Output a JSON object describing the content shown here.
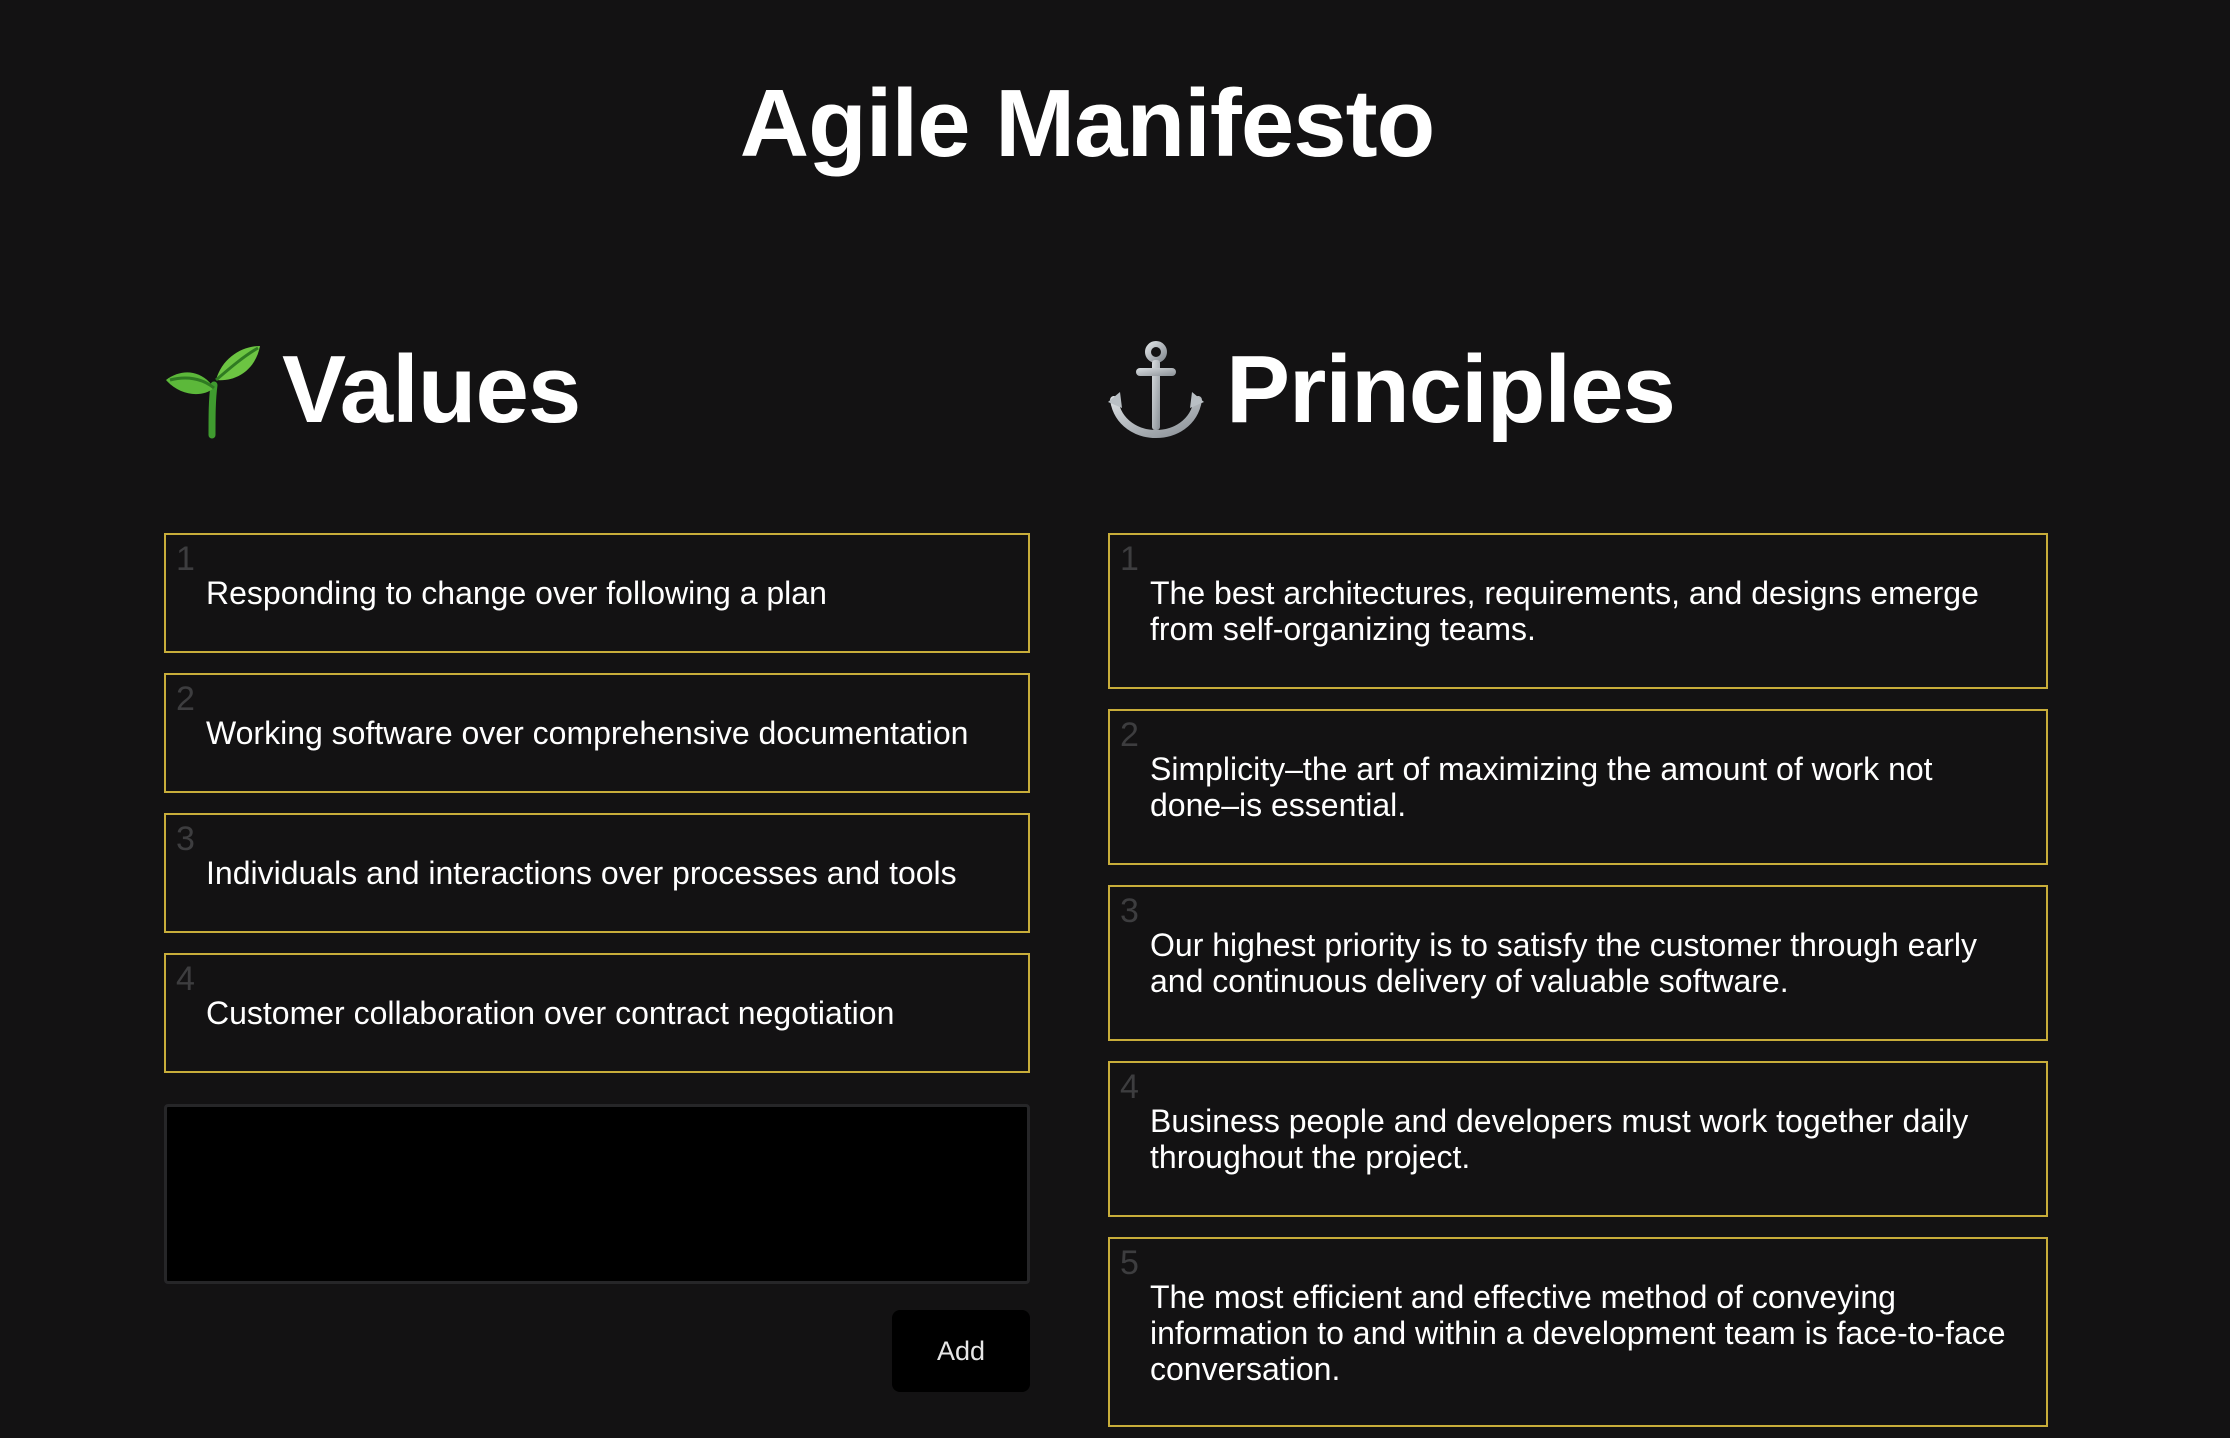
{
  "page": {
    "title": "Agile Manifesto"
  },
  "values": {
    "heading": "Values",
    "icon": "seedling-icon",
    "items": [
      {
        "index": "1",
        "text": "Responding to change over following a plan"
      },
      {
        "index": "2",
        "text": "Working software over comprehensive documentation"
      },
      {
        "index": "3",
        "text": "Individuals and interactions over processes and tools"
      },
      {
        "index": "4",
        "text": "Customer collaboration over contract negotiation"
      }
    ],
    "input_value": "",
    "add_label": "Add"
  },
  "principles": {
    "heading": "Principles",
    "icon": "anchor-icon",
    "items": [
      {
        "index": "1",
        "text": "The best architectures, requirements, and designs emerge from self-organizing teams."
      },
      {
        "index": "2",
        "text": "Simplicity–the art of maximizing the amount of work not done–is essential."
      },
      {
        "index": "3",
        "text": "Our highest priority is to satisfy the customer through early and continuous delivery of valuable software."
      },
      {
        "index": "4",
        "text": "Business people and developers must work together daily throughout the project."
      },
      {
        "index": "5",
        "text": "The most efficient and effective method of conveying information to and within a development team is face-to-face conversation."
      }
    ]
  },
  "colors": {
    "background": "#131213",
    "card_border": "#c8ad3a",
    "index_text": "#3d3d3f",
    "input_background": "#000000"
  }
}
